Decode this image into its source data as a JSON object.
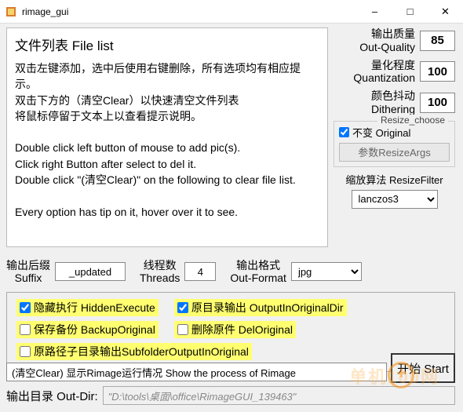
{
  "window": {
    "title": "rimage_gui"
  },
  "filelist": {
    "title": "文件列表 File list",
    "text": "双击左键添加，选中后使用右键删除，所有选项均有相应提示。\n双击下方的（清空Clear）以快速清空文件列表\n将鼠标停留于文本上以查看提示说明。\n\nDouble click left button of mouse to add pic(s).\nClick right Button after select to del it.\nDouble click \"(清空Clear)\" on the following to clear file list.\n\nEvery option has tip on it, hover over it to see."
  },
  "right": {
    "quality": {
      "label_cn": "输出质量",
      "label_en": "Out-Quality",
      "value": "85"
    },
    "quant": {
      "label_cn": "量化程度",
      "label_en": "Quantization",
      "value": "100"
    },
    "dither": {
      "label_cn": "颜色抖动",
      "label_en": "Dithering",
      "value": "100"
    },
    "resize_legend": "Resize_choose",
    "resize_unchanged": "不变 Original",
    "resize_args_btn": "参数ResizeArgs",
    "filter_label": "缩放算法 ResizeFilter",
    "filter_value": "lanczos3"
  },
  "mid": {
    "suffix": {
      "label_cn": "输出后缀",
      "label_en": "Suffix",
      "value": "_updated"
    },
    "threads": {
      "label_cn": "线程数",
      "label_en": "Threads",
      "value": "4"
    },
    "format": {
      "label_cn": "输出格式",
      "label_en": "Out-Format",
      "value": "jpg"
    }
  },
  "checks": {
    "hidden": "隐藏执行 HiddenExecute",
    "origdir": "原目录输出 OutputInOriginalDir",
    "backup": "保存备份 BackupOriginal",
    "delorig": "删除原件 DelOriginal",
    "subfolder": "原路径子目录输出SubfolderOutputInOriginal"
  },
  "process_text": "(清空Clear) 显示Rimage运行情况 Show the process of Rimage",
  "start_btn": "开始 Start",
  "outdir": {
    "label": "输出目录 Out-Dir:",
    "value": "\"D:\\tools\\桌面\\office\\RimageGUI_139463\""
  },
  "watermark": "单机100网"
}
